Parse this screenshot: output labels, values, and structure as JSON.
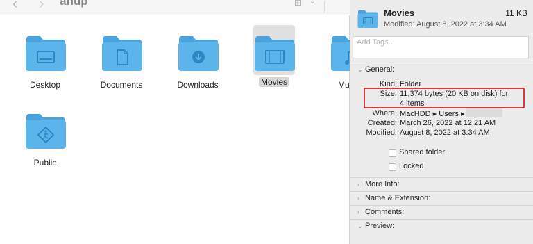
{
  "finder": {
    "window_title": "anup",
    "items": [
      {
        "label": "Desktop",
        "icon": "desktop-folder-icon"
      },
      {
        "label": "Documents",
        "icon": "documents-folder-icon"
      },
      {
        "label": "Downloads",
        "icon": "downloads-folder-icon"
      },
      {
        "label": "Movies",
        "icon": "movies-folder-icon",
        "selected": true
      },
      {
        "label": "Mu",
        "icon": "music-folder-icon"
      },
      {
        "label": "Public",
        "icon": "public-folder-icon"
      }
    ]
  },
  "info": {
    "name": "Movies",
    "size": "11 KB",
    "modified_header": "Modified: August 8, 2022 at 3:34 AM",
    "tags_placeholder": "Add Tags...",
    "general_label": "General:",
    "general": {
      "kind_label": "Kind:",
      "kind_value": "Folder",
      "size_label": "Size:",
      "size_value_line1": "11,374 bytes (20 KB on disk) for",
      "size_value_line2": "4 items",
      "where_label": "Where:",
      "where_value": "MacHDD ▸ Users ▸",
      "created_label": "Created:",
      "created_value": "March 26, 2022 at 12:21 AM",
      "modified_label": "Modified:",
      "modified_value": "August 8, 2022 at 3:34 AM"
    },
    "shared_folder_label": "Shared folder",
    "locked_label": "Locked",
    "sections": [
      "More Info:",
      "Name & Extension:",
      "Comments:",
      "Preview:"
    ]
  },
  "colors": {
    "folder_body": "#5cb5ea",
    "folder_tab": "#4aa3dc",
    "folder_glyph": "#2f86c5",
    "highlight": "#d23b3b"
  }
}
